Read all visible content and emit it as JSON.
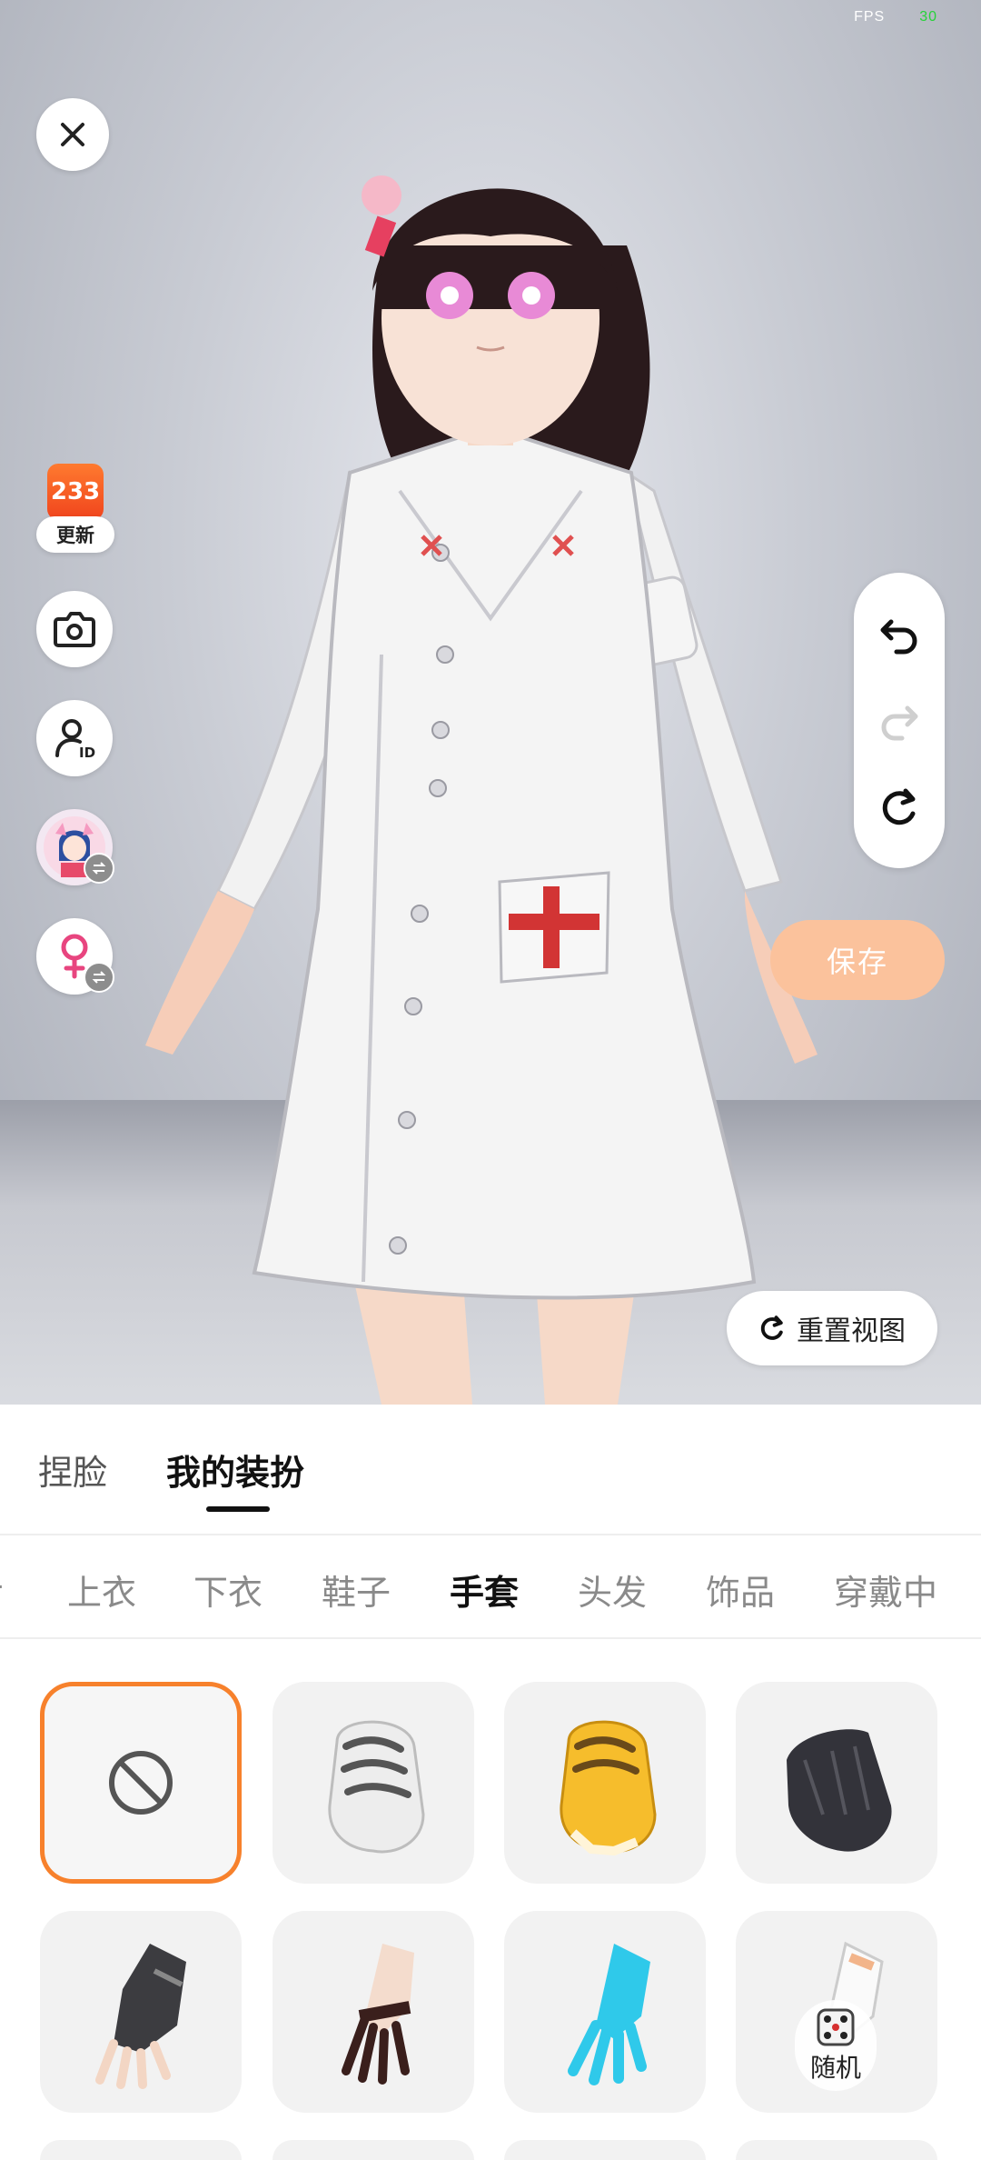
{
  "status": {
    "fps_label": "FPS",
    "fps_value": "30"
  },
  "left_toolbar": {
    "badge_number": "233",
    "badge_label": "更新"
  },
  "actions": {
    "save_label": "保存",
    "reset_view_label": "重置视图",
    "random_label": "随机"
  },
  "main_tabs": [
    {
      "label": "捏脸",
      "active": false
    },
    {
      "label": "我的装扮",
      "active": true
    }
  ],
  "sub_tabs": [
    {
      "label": "上衣",
      "active": false
    },
    {
      "label": "下衣",
      "active": false
    },
    {
      "label": "鞋子",
      "active": false
    },
    {
      "label": "手套",
      "active": true
    },
    {
      "label": "头发",
      "active": false
    },
    {
      "label": "饰品",
      "active": false
    },
    {
      "label": "穿戴中",
      "active": false
    }
  ],
  "items": [
    {
      "icon": "none-icon",
      "selected": true
    },
    {
      "icon": "white-paw-glove-icon",
      "selected": false
    },
    {
      "icon": "yellow-paw-glove-icon",
      "selected": false
    },
    {
      "icon": "black-glove-icon",
      "selected": false
    },
    {
      "icon": "fingerless-glove-icon",
      "selected": false
    },
    {
      "icon": "dark-lace-glove-icon",
      "selected": false
    },
    {
      "icon": "cyan-glove-icon",
      "selected": false
    },
    {
      "icon": "white-glove-icon",
      "selected": false
    }
  ],
  "colors": {
    "accent": "#f7812c",
    "save_button": "#fbc29c",
    "fps_value": "#27d23a"
  }
}
